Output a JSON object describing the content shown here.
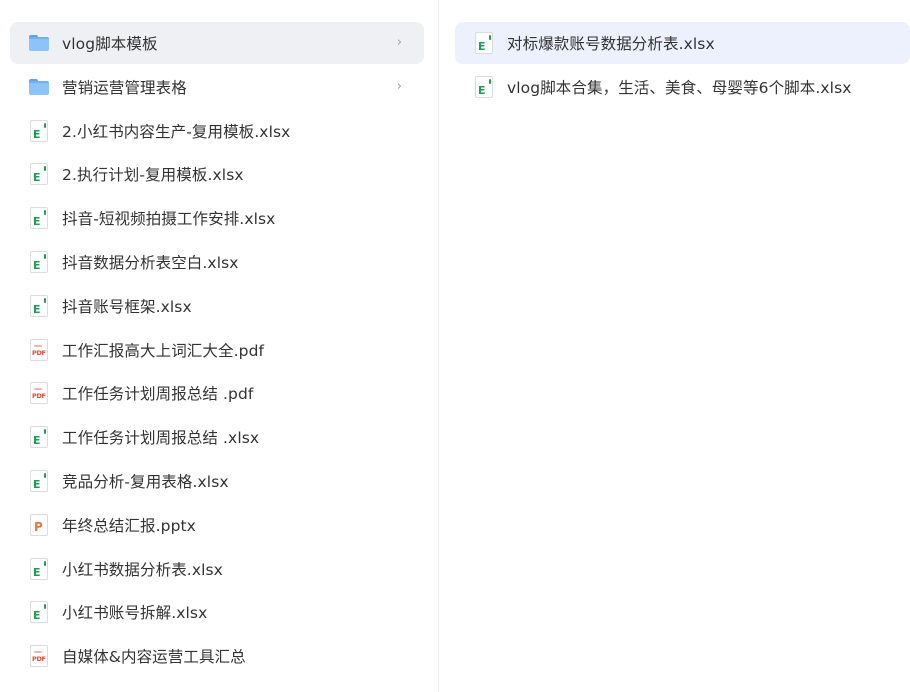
{
  "left_list": [
    {
      "label": "vlog脚本模板",
      "icon": "folder-icon",
      "kind": "folder",
      "selected": true,
      "has_chevron": true
    },
    {
      "label": "营销运营管理表格",
      "icon": "folder-icon",
      "kind": "folder",
      "selected": false,
      "has_chevron": true
    },
    {
      "label": "2.小红书内容生产-复用模板.xlsx",
      "icon": "excel-file-icon",
      "kind": "xlsx"
    },
    {
      "label": "2.执行计划-复用模板.xlsx",
      "icon": "excel-file-icon",
      "kind": "xlsx"
    },
    {
      "label": "抖音-短视频拍摄工作安排.xlsx",
      "icon": "excel-file-icon",
      "kind": "xlsx"
    },
    {
      "label": "抖音数据分析表空白.xlsx",
      "icon": "excel-file-icon",
      "kind": "xlsx"
    },
    {
      "label": "抖音账号框架.xlsx",
      "icon": "excel-file-icon",
      "kind": "xlsx"
    },
    {
      "label": "工作汇报高大上词汇大全.pdf",
      "icon": "pdf-file-icon",
      "kind": "pdf"
    },
    {
      "label": "工作任务计划周报总结 .pdf",
      "icon": "pdf-file-icon",
      "kind": "pdf"
    },
    {
      "label": "工作任务计划周报总结 .xlsx",
      "icon": "excel-file-icon",
      "kind": "xlsx"
    },
    {
      "label": "竞品分析-复用表格.xlsx",
      "icon": "excel-file-icon",
      "kind": "xlsx"
    },
    {
      "label": "年终总结汇报.pptx",
      "icon": "powerpoint-file-icon",
      "kind": "pptx"
    },
    {
      "label": "小红书数据分析表.xlsx",
      "icon": "excel-file-icon",
      "kind": "xlsx"
    },
    {
      "label": "小红书账号拆解.xlsx",
      "icon": "excel-file-icon",
      "kind": "xlsx"
    },
    {
      "label": "自媒体&内容运营工具汇总",
      "icon": "pdf-file-icon",
      "kind": "pdf"
    }
  ],
  "right_list": [
    {
      "label": "对标爆款账号数据分析表.xlsx",
      "icon": "excel-file-icon",
      "kind": "xlsx",
      "selected": true
    },
    {
      "label": "vlog脚本合集，生活、美食、母婴等6个脚本.xlsx",
      "icon": "excel-file-icon",
      "kind": "xlsx",
      "selected": false
    }
  ],
  "chevron_glyph": "›",
  "colors": {
    "selected_left_bg": "#eef0f3",
    "selected_right_bg": "#ecf1fd",
    "excel_green": "#1f9d55",
    "pdf_red": "#e5483b",
    "ppt_orange": "#e8773b",
    "folder_blue": "#8cc4f8"
  }
}
